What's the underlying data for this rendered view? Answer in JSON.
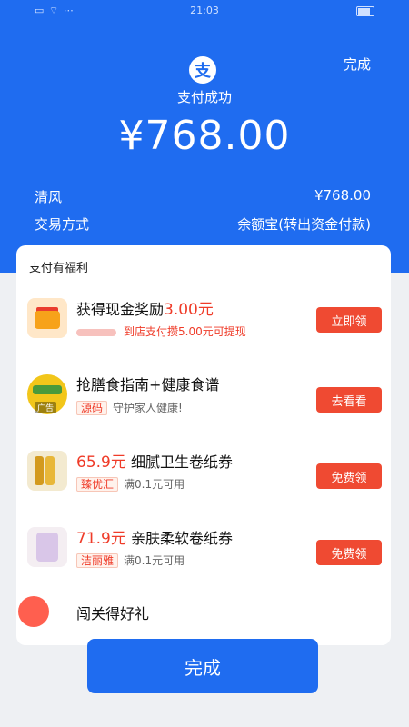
{
  "status_bar": {
    "left_icons": "▭ ⌔ ⋯",
    "time": "21:03"
  },
  "header": {
    "top_done": "完成",
    "logo_glyph": "支",
    "pay_status": "支付成功",
    "amount": "¥768.00",
    "rows": [
      {
        "label": "清风",
        "value": "¥768.00"
      },
      {
        "label": "交易方式",
        "value": "余额宝(转出资金付款)"
      }
    ]
  },
  "benefits": {
    "title": "支付有福利",
    "items": [
      {
        "title_prefix": "获得现金奖励",
        "title_red": "3.00元",
        "sub_red": "到店支付攒5.00元可提现",
        "button": "立即领"
      },
      {
        "title": "抢膳食指南+健康食谱",
        "tag": "源码",
        "sub": "守护家人健康!",
        "thumb_label": "广告",
        "button": "去看看"
      },
      {
        "title_red": "65.9元",
        "title_suffix": "细腻卫生卷纸券",
        "tag": "臻优汇",
        "sub": "满0.1元可用",
        "button": "免费领"
      },
      {
        "title_red": "71.9元",
        "title_suffix": "亲肤柔软卷纸券",
        "tag": "洁丽雅",
        "sub": "满0.1元可用",
        "button": "免费领"
      },
      {
        "title": "闯关得好礼"
      }
    ]
  },
  "footer": {
    "done_button": "完成"
  },
  "colors": {
    "primary_blue": "#1f6cf0",
    "accent_red": "#ef4a32"
  }
}
